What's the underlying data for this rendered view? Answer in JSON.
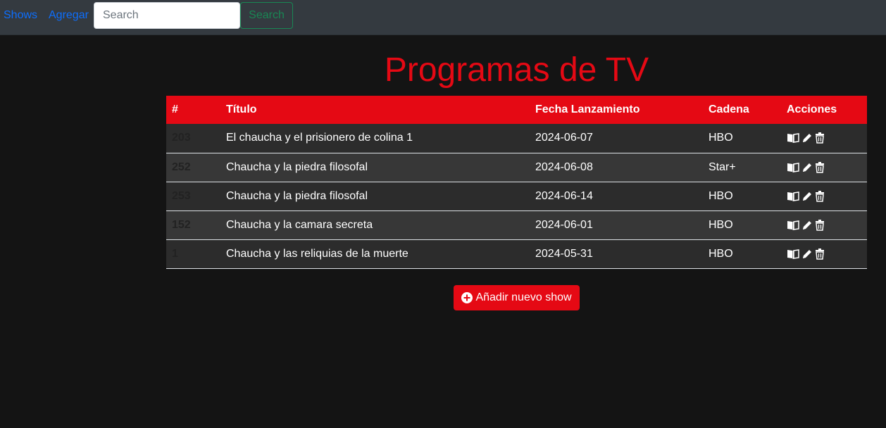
{
  "nav": {
    "shows_label": "Shows",
    "add_label": "Agregar",
    "search_placeholder": "Search",
    "search_button": "Search"
  },
  "page": {
    "title": "Programas de TV"
  },
  "table": {
    "headers": {
      "id": "#",
      "title": "Título",
      "date": "Fecha Lanzamiento",
      "network": "Cadena",
      "actions": "Acciones"
    },
    "rows": [
      {
        "id": "203",
        "title": "El chaucha y el prisionero de colina 1",
        "date": "2024-06-07",
        "network": "HBO"
      },
      {
        "id": "252",
        "title": "Chaucha y la piedra filosofal",
        "date": "2024-06-08",
        "network": "Star+"
      },
      {
        "id": "253",
        "title": "Chaucha y la piedra filosofal",
        "date": "2024-06-14",
        "network": "HBO"
      },
      {
        "id": "152",
        "title": "Chaucha y la camara secreta",
        "date": "2024-06-01",
        "network": "HBO"
      },
      {
        "id": "1",
        "title": "Chaucha y las reliquias de la muerte",
        "date": "2024-05-31",
        "network": "HBO"
      }
    ],
    "action_icons": [
      "book-icon",
      "pencil-icon",
      "trash-icon"
    ]
  },
  "add_button": {
    "label": "Añadir nuevo show",
    "icon": "plus-circle-icon"
  },
  "colors": {
    "accent": "#e50914",
    "navbar": "#343a40",
    "background": "#141414",
    "link": "#0d6efd",
    "success": "#198754"
  }
}
